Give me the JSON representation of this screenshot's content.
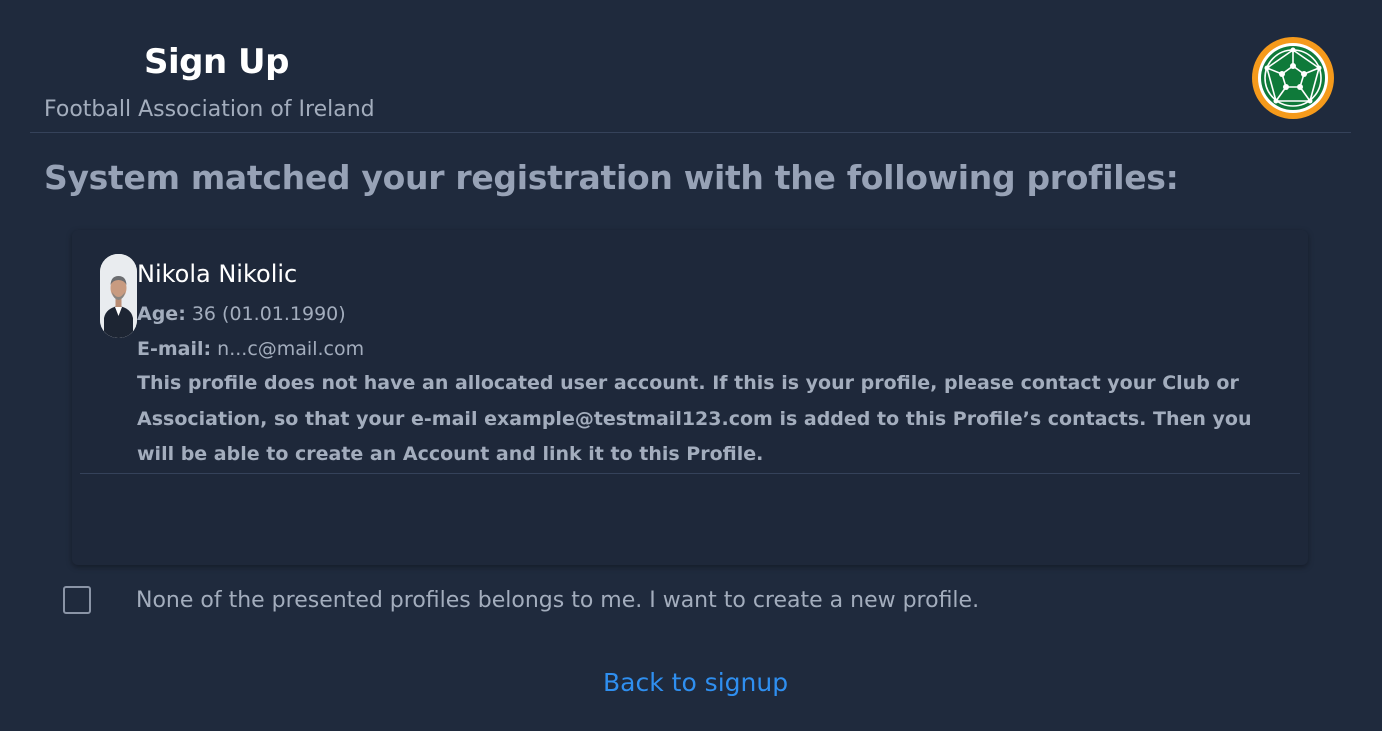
{
  "header": {
    "title": "Sign Up",
    "subtitle": "Football Association of Ireland"
  },
  "logo": {
    "icon": "football-logo-icon",
    "colors": {
      "ring": "#f59a1b",
      "inner": "#0f7a3a",
      "net": "#ffffff"
    }
  },
  "matched_heading": "System matched your registration with the following profiles:",
  "profile": {
    "name": "Nikola Nikolic",
    "age_label": "Age:",
    "age_value": "36 (01.01.1990)",
    "email_label": "E-mail:",
    "email_value": "n...c@mail.com",
    "notice": "This profile does not have an allocated user account. If this is your profile, please contact your Club or Association, so that your e-mail example@testmail123.com is added to this Profile’s contacts. Then you will be able to create an Account and link it to this Profile."
  },
  "new_profile": {
    "label": "None of the presented profiles belongs to me. I want to create a new profile.",
    "checked": false
  },
  "back_link": "Back to signup",
  "colors": {
    "background": "#1f2a3d",
    "link": "#2f8ff0",
    "muted_text": "#a3adbd"
  }
}
